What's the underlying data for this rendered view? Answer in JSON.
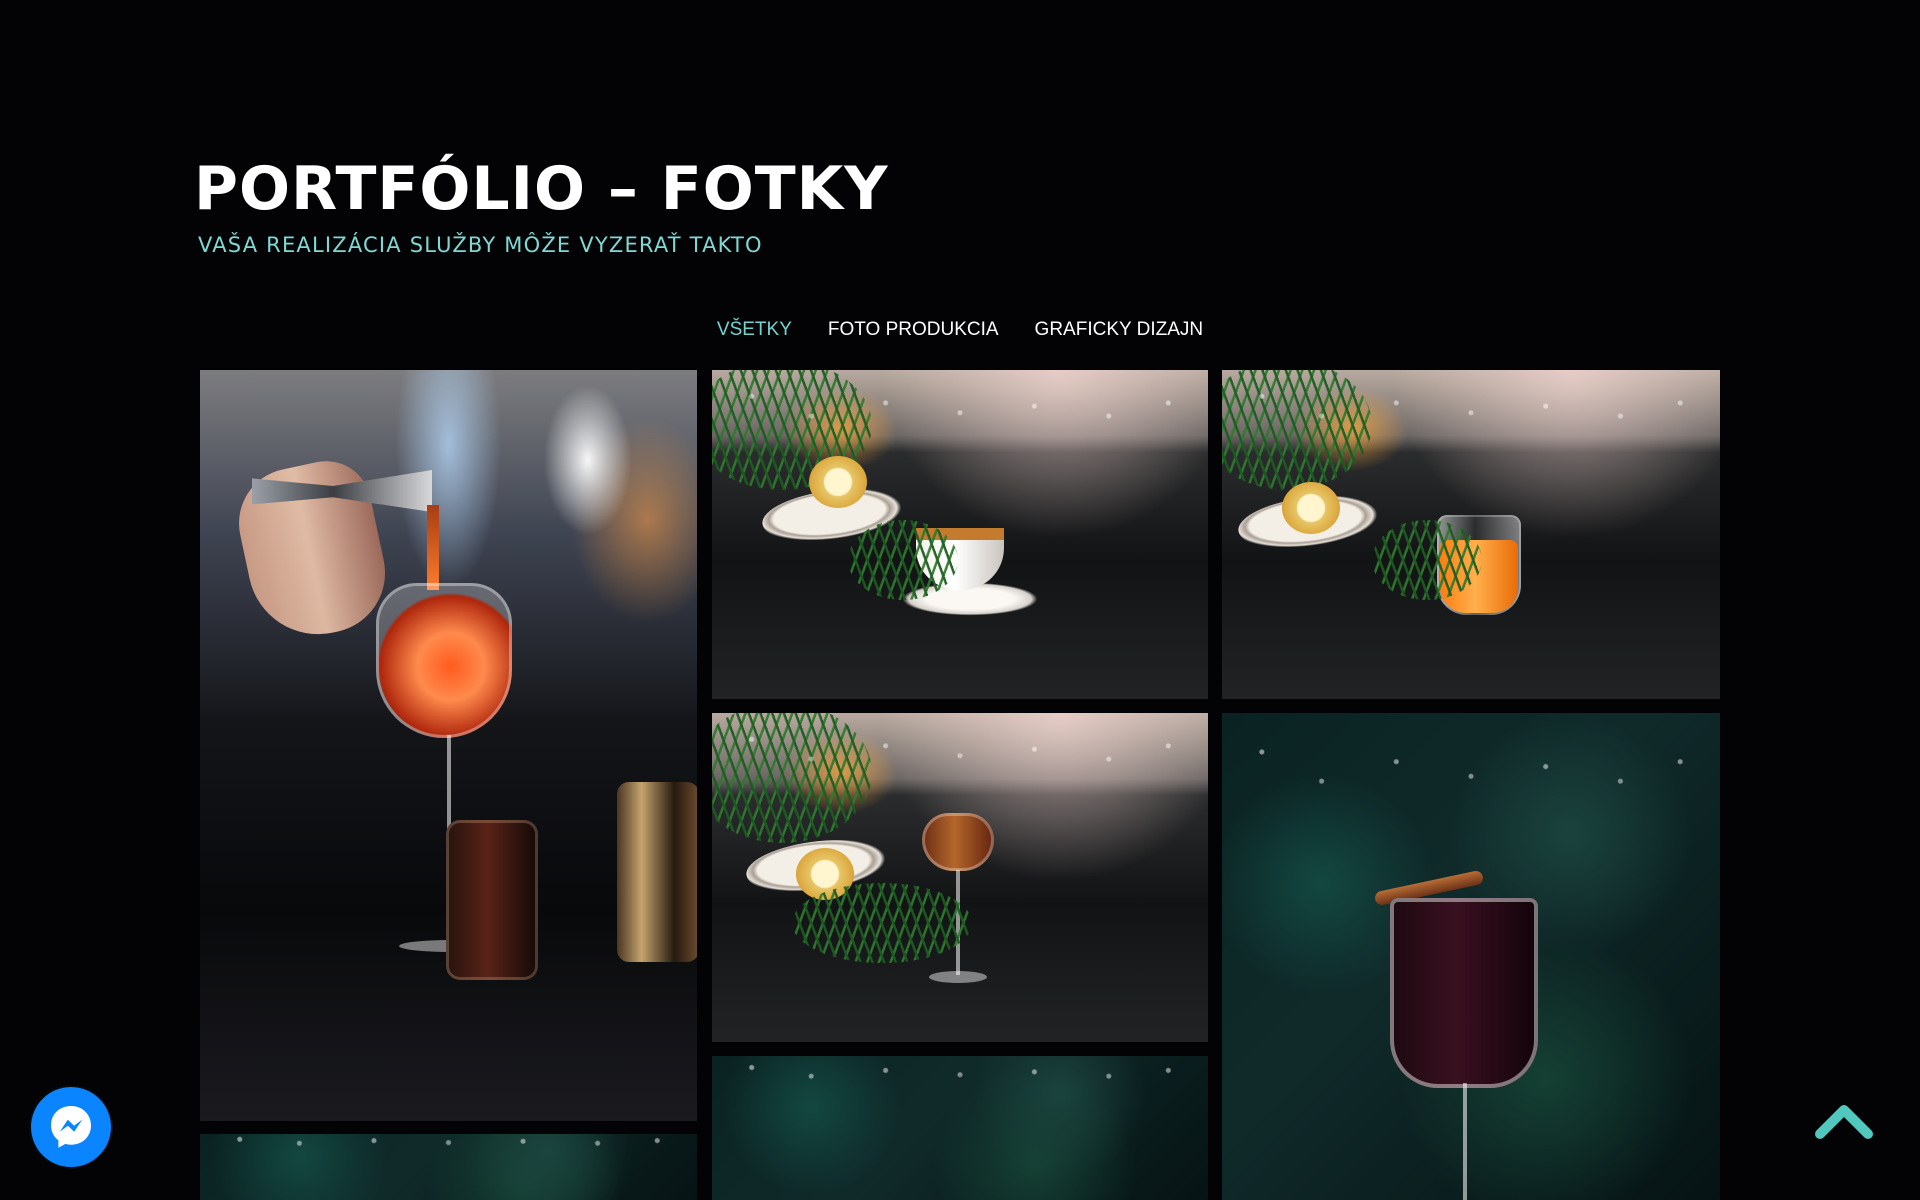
{
  "header": {
    "title": "PORTFÓLIO – FOTKY",
    "subtitle": "VAŠA REALIZÁCIA SLUŽBY MÔŽE VYZERAŤ TAKTO"
  },
  "filters": [
    {
      "label": "VŠETKY",
      "active": true
    },
    {
      "label": "FOTO PRODUKCIA",
      "active": false
    },
    {
      "label": "GRAFICKY DIZAJN",
      "active": false
    }
  ],
  "gallery": {
    "items": [
      "photo-spritz-pour",
      "photo-tea-cup",
      "photo-orange-drink",
      "photo-amber-drink",
      "photo-mulled-wine",
      "photo-tree-lights",
      "photo-dark-tree"
    ]
  },
  "floating_buttons": {
    "messenger": "messenger-icon",
    "scroll_top": "chevron-up-icon"
  },
  "colors": {
    "accent": "#72d4cf",
    "background": "#030306",
    "messenger": "#0b84ff"
  }
}
